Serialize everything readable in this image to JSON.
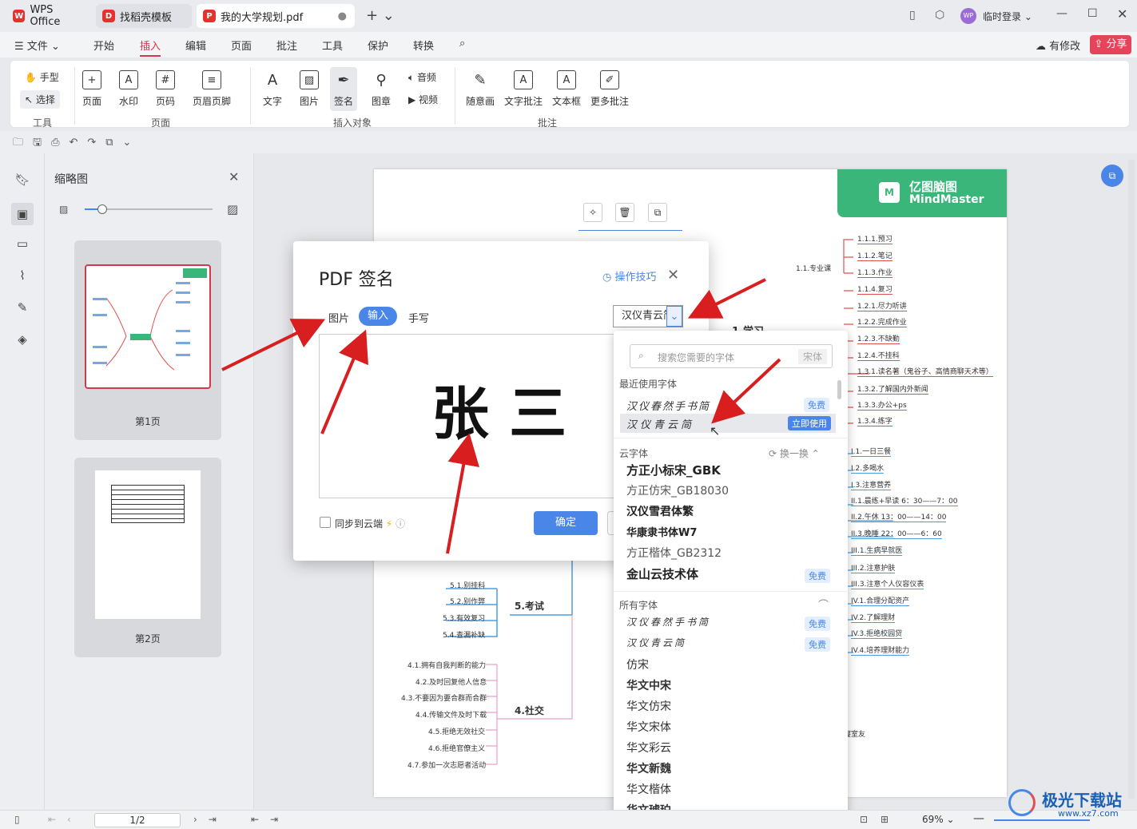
{
  "tabs": [
    {
      "label": "WPS Office"
    },
    {
      "label": "找稻壳模板"
    },
    {
      "label": "我的大学规划.pdf"
    }
  ],
  "title_right": {
    "login": "临时登录",
    "avatar": "WP"
  },
  "menu": [
    "文件",
    "开始",
    "插入",
    "编辑",
    "页面",
    "批注",
    "工具",
    "保护",
    "转换"
  ],
  "menu_right": {
    "changes": "有修改",
    "share": "分享"
  },
  "ribbon": {
    "tools": [
      "手型",
      "选择"
    ],
    "page": [
      "页面",
      "水印",
      "页码",
      "页眉页脚"
    ],
    "objects": [
      "文字",
      "图片",
      "签名",
      "图章",
      "音频",
      "视频"
    ],
    "annot": [
      "随意画",
      "文字批注",
      "文本框",
      "更多批注"
    ],
    "groups": [
      "工具",
      "页面",
      "插入对象",
      "批注"
    ]
  },
  "thumb": {
    "title": "缩略图",
    "pages": [
      "第1页",
      "第2页"
    ]
  },
  "status": {
    "page": "1/2",
    "zoom": "69%"
  },
  "dialog": {
    "title": "PDF 签名",
    "tips": "操作技巧",
    "tabs": [
      "图片",
      "输入",
      "手写"
    ],
    "font_selected": "汉仪青云简",
    "signature": "张 三",
    "sync": "同步到云端",
    "confirm": "确定"
  },
  "dropdown": {
    "search_placeholder": "搜索您需要的字体",
    "search_hint": "宋体",
    "recent_title": "最近使用字体",
    "recent": [
      {
        "name": "汉仪春然手书简",
        "badge": "免费"
      },
      {
        "name": "汉仪青云简",
        "badge": "立即使用"
      }
    ],
    "cloud_title": "云字体",
    "cloud_switch": "换一换",
    "cloud": [
      {
        "name": "方正小标宋_GBK"
      },
      {
        "name": "方正仿宋_GB18030"
      },
      {
        "name": "汉仪雪君体繁"
      },
      {
        "name": "华康隶书体W7"
      },
      {
        "name": "方正楷体_GB2312"
      },
      {
        "name": "金山云技术体",
        "badge": "免费"
      }
    ],
    "all_title": "所有字体",
    "all": [
      {
        "name": "汉仪春然手书简",
        "badge": "免费"
      },
      {
        "name": "汉仪青云简",
        "badge": "免费"
      },
      {
        "name": "仿宋"
      },
      {
        "name": "华文中宋"
      },
      {
        "name": "华文仿宋"
      },
      {
        "name": "华文宋体"
      },
      {
        "name": "华文彩云"
      },
      {
        "name": "华文新魏"
      },
      {
        "name": "华文楷体"
      },
      {
        "name": "华文琥珀"
      }
    ]
  },
  "mindmap": {
    "brand_cn": "亿图脑图",
    "brand_en": "MindMaster",
    "right_nodes": [
      "1.1.1.预习",
      "1.1.2.笔记",
      "1.1.3.作业",
      "1.1.4.复习",
      "1.2.1.尽力听讲",
      "1.2.2.完成作业",
      "1.2.3.不缺勤",
      "1.2.4.不挂科",
      "1.3.1.读名著（鬼谷子、高情商聊天术等）",
      "1.3.2.了解国内外新闻",
      "1.3.3.办公+ps",
      "1.3.4.练字",
      "I.1.一日三餐",
      "I.2.多喝水",
      "I.3.注意营养",
      "II.1.晨练+早读 6：30——7：00",
      "II.2.午休 13：00——14：00",
      "II.3.晚睡 22：00——6：60",
      "III.1.生病早就医",
      "III.2.注意护肤",
      "III.3.注意个人仪容仪表",
      "IV.1.合理分配资产",
      "IV.2.了解理财",
      "IV.3.拒绝校园贷",
      "IV.4.培养理财能力"
    ],
    "branch_study": "1.学习",
    "branch_major": "1.1.专业课",
    "exam": "5.考试",
    "social": "4.社交",
    "exam_nodes": [
      "5.1.别挂科",
      "5.2.别作弊",
      "5.3.有效复习",
      "5.4.查漏补缺"
    ],
    "social_nodes": [
      "4.1.拥有自我判断的能力",
      "4.2.及时回复他人信息",
      "4.3.不要因为要合群而合群",
      "4.4.传输文件及时下载",
      "4.5.拒绝无效社交",
      "4.6.拒绝官僚主义",
      "4.7.参加一次志愿者活动"
    ],
    "misc": "寝室友"
  },
  "watermark": "极光下载站",
  "watermark_url": "www.xz7.com"
}
